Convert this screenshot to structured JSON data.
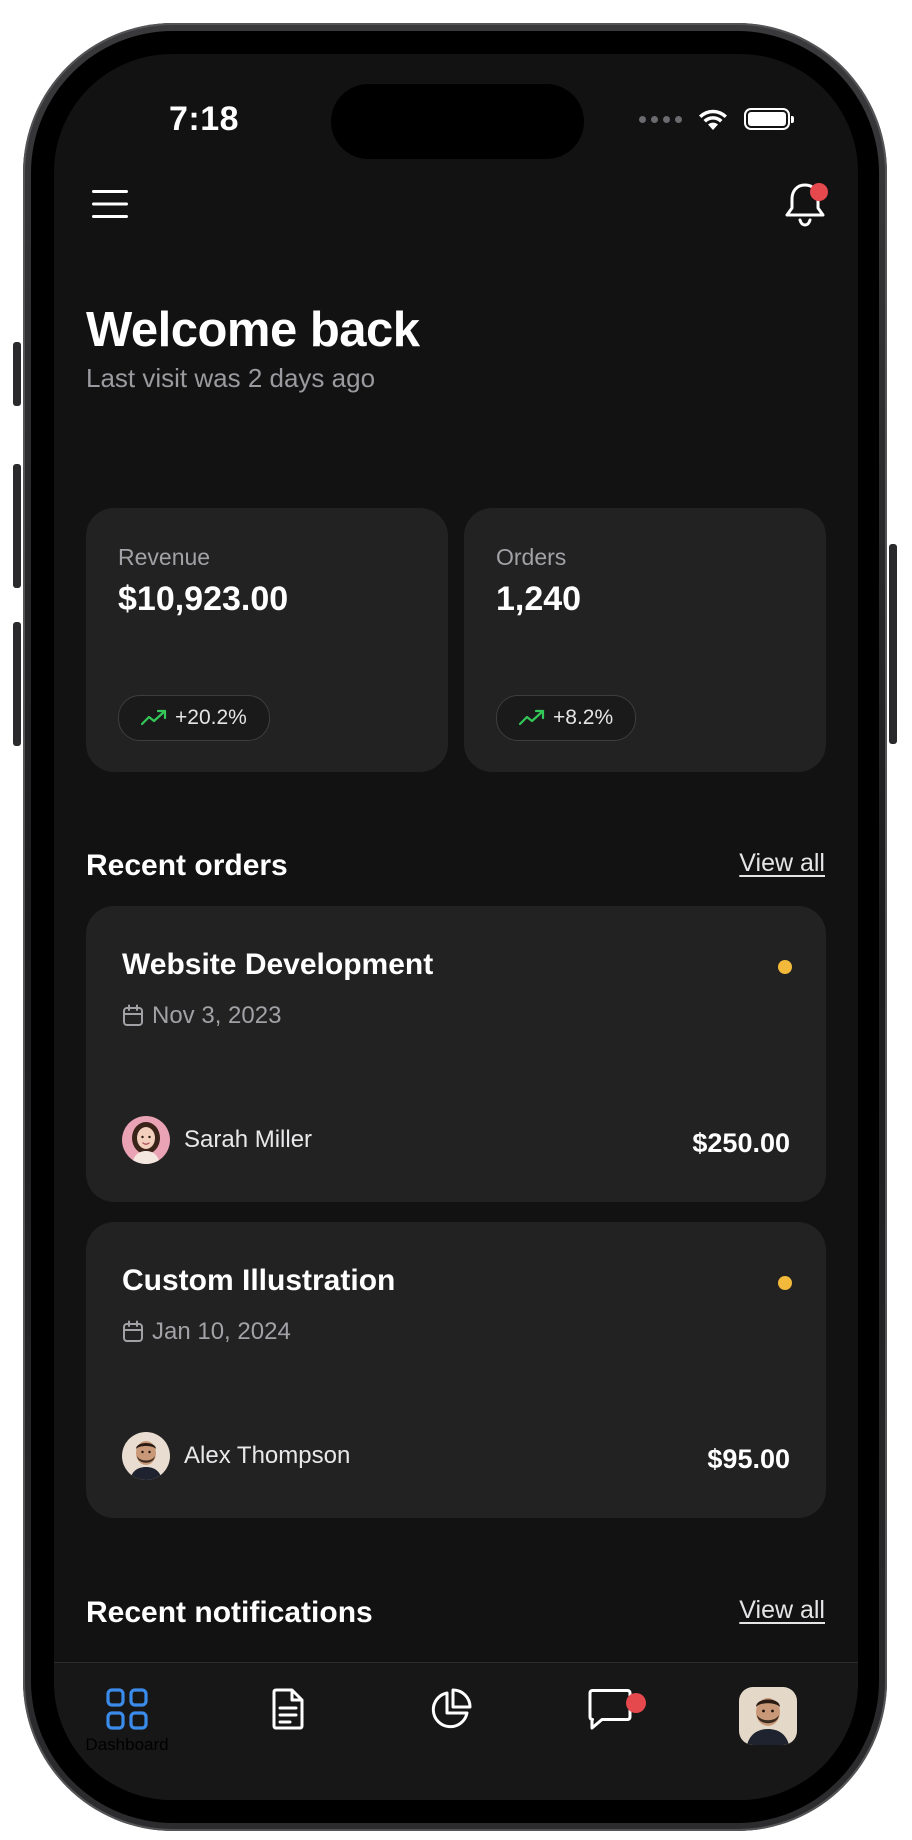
{
  "status_bar": {
    "time": "7:18"
  },
  "header": {
    "menu_icon": "hamburger-menu-icon",
    "bell_icon": "bell-icon"
  },
  "welcome": {
    "title": "Welcome back",
    "subtitle": "Last visit was 2 days ago"
  },
  "stats": [
    {
      "label": "Revenue",
      "value": "$10,923.00",
      "trend": "+20.2%",
      "trend_icon": "trending-up-icon"
    },
    {
      "label": "Orders",
      "value": "1,240",
      "trend": "+8.2%",
      "trend_icon": "trending-up-icon"
    }
  ],
  "recent_orders": {
    "title": "Recent orders",
    "view_all": "View all",
    "items": [
      {
        "title": "Website Development",
        "date": "Nov 3, 2023",
        "person": "Sarah Miller",
        "amount": "$250.00",
        "status_color": "#f2b93b"
      },
      {
        "title": "Custom Illustration",
        "date": "Jan 10, 2024",
        "person": "Alex Thompson",
        "amount": "$95.00",
        "status_color": "#f2b93b"
      }
    ]
  },
  "recent_notifications": {
    "title": "Recent notifications",
    "view_all": "View all"
  },
  "tabbar": {
    "items": [
      {
        "label": "Dashboard",
        "icon": "dashboard-grid-icon",
        "active": true
      },
      {
        "label": "",
        "icon": "document-icon"
      },
      {
        "label": "",
        "icon": "pie-chart-icon"
      },
      {
        "label": "",
        "icon": "message-icon"
      },
      {
        "label": "",
        "icon": "profile-avatar"
      }
    ]
  },
  "colors": {
    "background": "#121212",
    "card": "#222222",
    "accent_blue": "#3b8beb",
    "trend_green": "#34c759",
    "notification_red": "#e5484d",
    "status_yellow": "#f2b93b"
  }
}
